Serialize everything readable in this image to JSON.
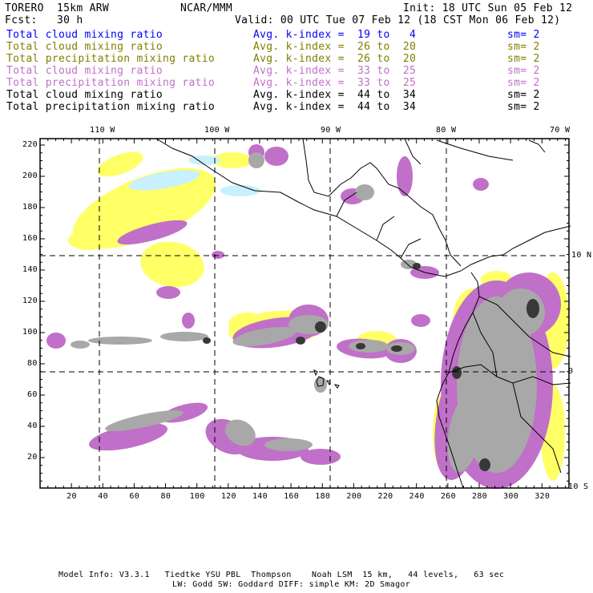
{
  "header": {
    "model": "TORERO  15km ARW",
    "org": "NCAR/MMM",
    "init": "Init: 18 UTC Sun 05 Feb 12",
    "fcst": "Fcst:   30 h",
    "valid": "Valid: 00 UTC Tue 07 Feb 12 (18 CST Mon 06 Feb 12)"
  },
  "legend": [
    {
      "field": "Total cloud mixing ratio",
      "index": "Avg. k-index =  19 to   4",
      "sm": "sm= 2",
      "color": "#0000ff"
    },
    {
      "field": "Total cloud mixing ratio",
      "index": "Avg. k-index =  26 to  20",
      "sm": "sm= 2",
      "color": "#808000"
    },
    {
      "field": "Total precipitation mixing ratio",
      "index": "Avg. k-index =  26 to  20",
      "sm": "sm= 2",
      "color": "#808000"
    },
    {
      "field": "Total cloud mixing ratio",
      "index": "Avg. k-index =  33 to  25",
      "sm": "sm= 2",
      "color": "#c070c8"
    },
    {
      "field": "Total precipitation mixing ratio",
      "index": "Avg. k-index =  33 to  25",
      "sm": "sm= 2",
      "color": "#c070c8"
    },
    {
      "field": "Total cloud mixing ratio",
      "index": "Avg. k-index =  44 to  34",
      "sm": "sm= 2",
      "color": "#000000"
    },
    {
      "field": "Total precipitation mixing ratio",
      "index": "Avg. k-index =  44 to  34",
      "sm": "sm= 2",
      "color": "#000000"
    }
  ],
  "axes": {
    "lon_labels": [
      "110 W",
      "100 W",
      "90 W",
      "80 W",
      "70 W"
    ],
    "lat_labels": [
      "10 N",
      "0",
      "10 S"
    ],
    "x_ticks": [
      "20",
      "40",
      "60",
      "80",
      "100",
      "120",
      "140",
      "160",
      "180",
      "200",
      "220",
      "240",
      "260",
      "280",
      "300",
      "320"
    ],
    "y_ticks": [
      "220",
      "200",
      "180",
      "160",
      "140",
      "120",
      "100",
      "80",
      "60",
      "40",
      "20"
    ]
  },
  "footer": {
    "line1": "Model Info: V3.3.1   Tiedtke YSU PBL  Thompson    Noah LSM  15 km,   44 levels,   63 sec",
    "line2": "LW: Godd SW: Goddard DIFF: simple KM: 2D Smagor"
  },
  "colors": {
    "yellow": "#ffff66",
    "lightblue": "#c8f0ff",
    "magenta": "#c070c8",
    "gray": "#a8a8a8",
    "dark": "#383838"
  }
}
